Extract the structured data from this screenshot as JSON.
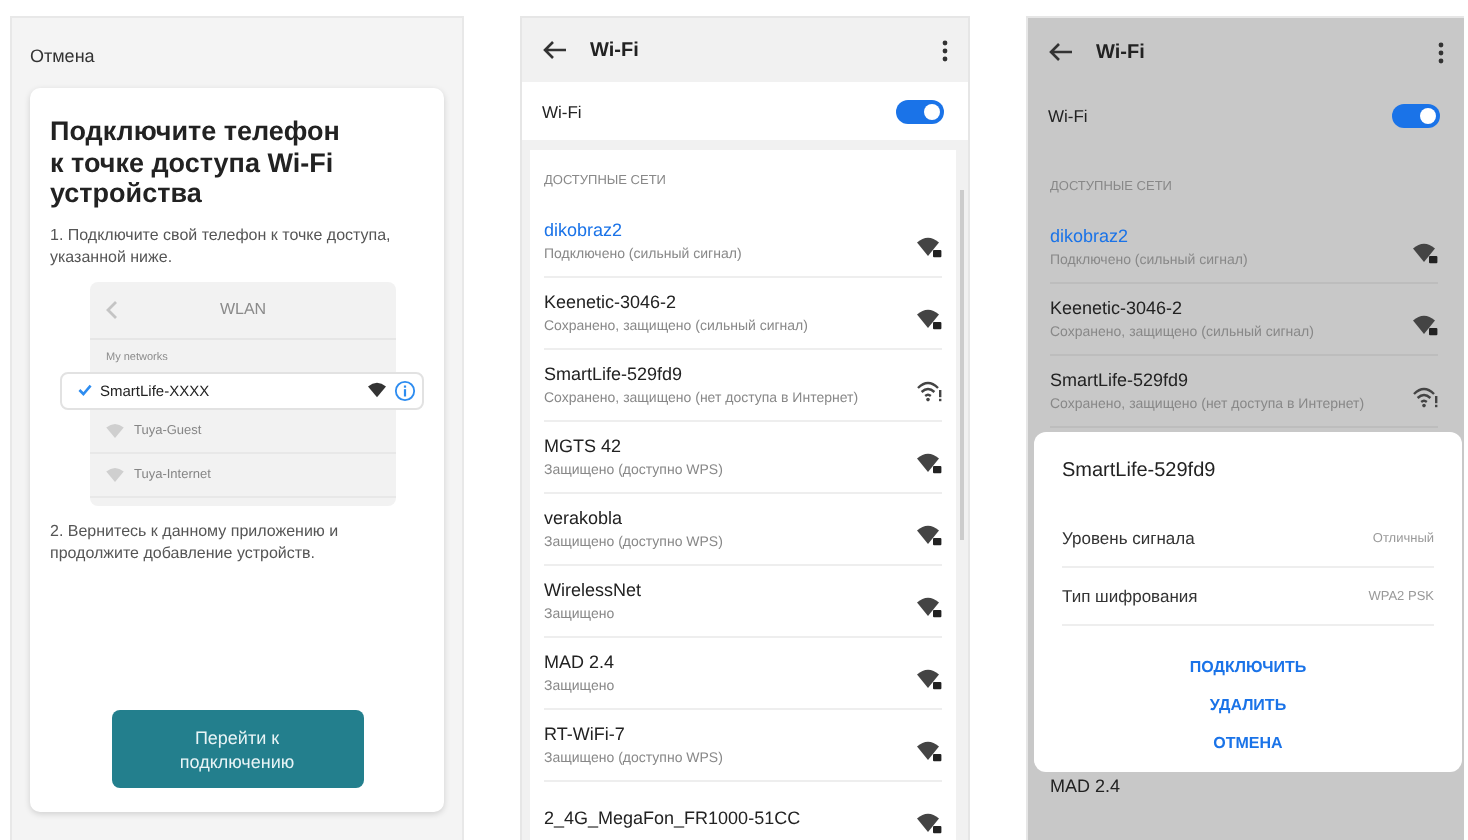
{
  "setup_screen": {
    "cancel": "Отмена",
    "title": "Подключите телефон к точке доступа Wi-Fi устройства",
    "step_1": "1. Подключите свой телефон к точке доступа, указанной ниже.",
    "mockup": {
      "title": "WLAN",
      "section": "My networks",
      "networks": [
        {
          "name": "SmartLife-XXXX",
          "selected": true
        },
        {
          "name": "Tuya-Guest",
          "selected": false
        },
        {
          "name": "Tuya-Internet",
          "selected": false
        }
      ]
    },
    "step_2": "2. Вернитесь к данному приложению и продолжите добавление устройств.",
    "button": "Перейти к подключению"
  },
  "wifi_screen": {
    "title": "Wi-Fi",
    "toggle_label": "Wi-Fi",
    "on": true,
    "section": "ДОСТУПНЫЕ СЕТИ",
    "networks": [
      {
        "name": "dikobraz2",
        "status": "Подключено (сильный сигнал)",
        "connected": true,
        "warning": false
      },
      {
        "name": "Keenetic-3046-2",
        "status": "Сохранено, защищено (сильный сигнал)",
        "connected": false,
        "warning": false
      },
      {
        "name": "SmartLife-529fd9",
        "status": "Сохранено, защищено (нет доступа в Интернет)",
        "connected": false,
        "warning": true
      },
      {
        "name": "MGTS 42",
        "status": "Защищено (доступно WPS)",
        "connected": false,
        "warning": false
      },
      {
        "name": "verakobla",
        "status": "Защищено (доступно WPS)",
        "connected": false,
        "warning": false
      },
      {
        "name": "WirelessNet",
        "status": "Защищено",
        "connected": false,
        "warning": false
      },
      {
        "name": "MAD 2.4",
        "status": "Защищено",
        "connected": false,
        "warning": false
      },
      {
        "name": "RT-WiFi-7",
        "status": "Защищено (доступно WPS)",
        "connected": false,
        "warning": false
      },
      {
        "name": "2_4G_MegaFon_FR1000-51CC",
        "connected": false,
        "warning": false
      }
    ]
  },
  "dialog_screen": {
    "dimmed": true,
    "title": "Wi-Fi",
    "toggle_label": "Wi-Fi",
    "on": true,
    "section": "ДОСТУПНЫЕ СЕТИ",
    "networks": [
      {
        "name": "dikobraz2",
        "status": "Подключено (сильный сигнал)",
        "connected": true,
        "warning": false
      },
      {
        "name": "Keenetic-3046-2",
        "status": "Сохранено, защищено (сильный сигнал)",
        "connected": false,
        "warning": false
      },
      {
        "name": "SmartLife-529fd9",
        "status": "Сохранено, защищено (нет доступа в Интернет)",
        "connected": false,
        "warning": true
      }
    ],
    "dialog": {
      "title": "SmartLife-529fd9",
      "rows": [
        {
          "label": "Уровень сигнала",
          "value": "Отличный"
        },
        {
          "label": "Тип шифрования",
          "value": "WPA2 PSK"
        }
      ],
      "actions": [
        "ПОДКЛЮЧИТЬ",
        "УДАЛИТЬ",
        "ОТМЕНА"
      ]
    },
    "networks_below": [
      {
        "name": "MAD 2.4"
      }
    ]
  }
}
